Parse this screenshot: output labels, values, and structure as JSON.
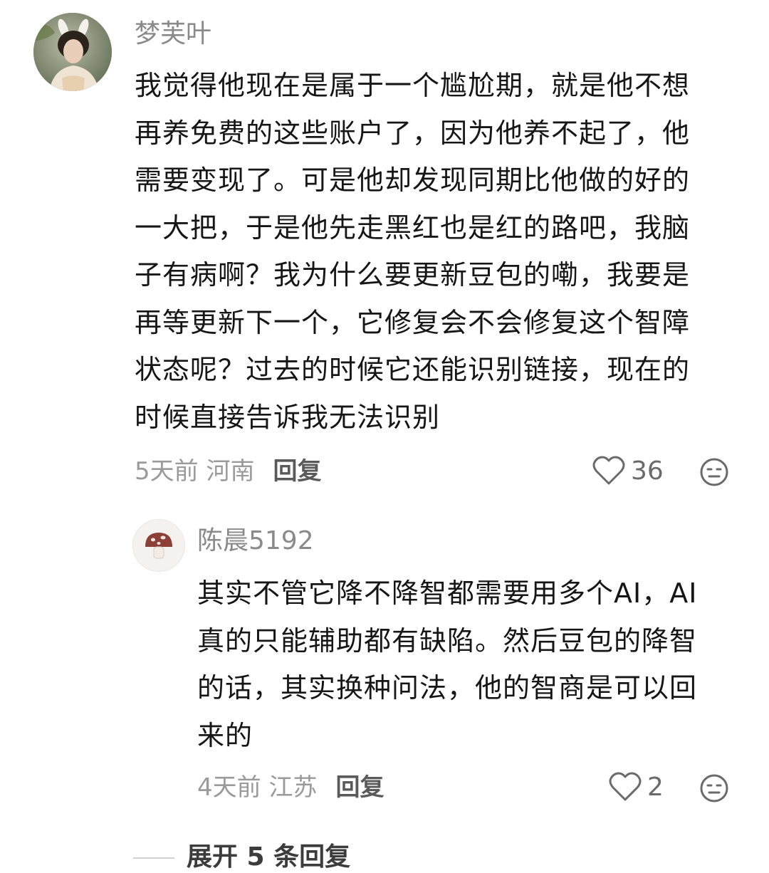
{
  "comment": {
    "username": "梦芙叶",
    "lines": [
      "我觉得他现在是属于一个尴尬期，就是他不想",
      "再养免费的这些账户了，因为他养不起了，他",
      "需要变现了。可是他却发现同期比他做的好的",
      "一大把，于是他先走黑红也是红的路吧，我脑",
      "子有病啊？我为什么要更新豆包的嘞，我要是",
      "再等更新下一个，它修复会不会修复这个智障",
      "状态呢？过去的时候它还能识别链接，现在的",
      "时候直接告诉我无法识别"
    ],
    "time_location": "5天前 河南",
    "reply_label": "回复",
    "like_count": "36",
    "icons": {
      "like": "heart-outline-icon",
      "emoji": "emoji-face-icon"
    }
  },
  "reply": {
    "username": "陈晨5192",
    "lines": [
      "其实不管它降不降智都需要用多个AI，AI",
      "真的只能辅助都有缺陷。然后豆包的降智",
      "的话，其实换种问法，他的智商是可以回",
      "来的"
    ],
    "time_location": "4天前 江苏",
    "reply_label": "回复",
    "like_count": "2",
    "icons": {
      "avatar": "mushroom-icon",
      "like": "heart-outline-icon",
      "emoji": "emoji-face-icon"
    }
  },
  "expand": {
    "label": "展开 5 条回复"
  },
  "colors": {
    "text_primary": "#161616",
    "text_secondary": "#8a8a8a",
    "text_meta": "#9a9a9a",
    "icon_gray": "#6a6a6a"
  }
}
